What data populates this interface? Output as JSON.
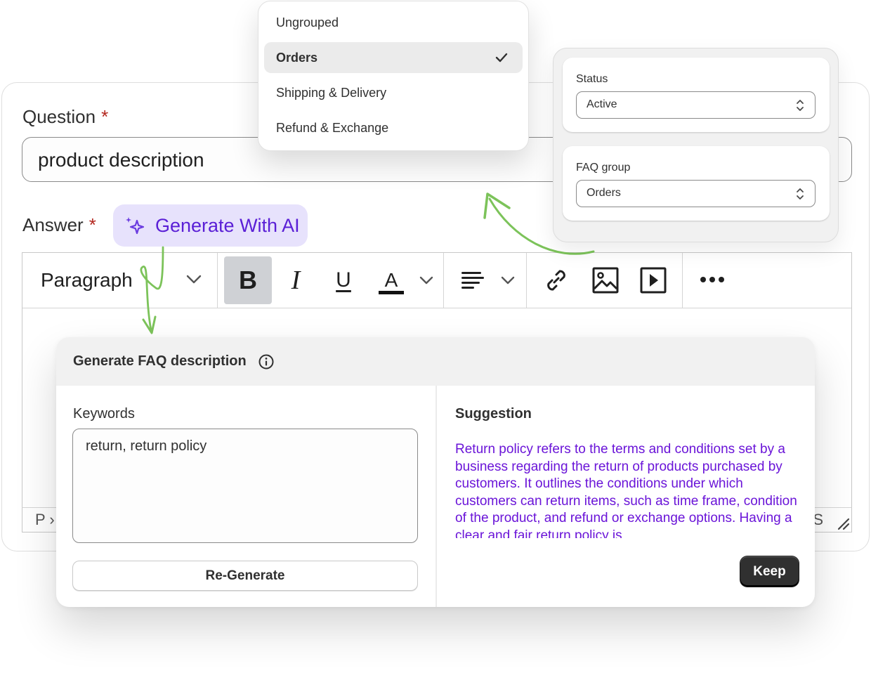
{
  "question": {
    "label": "Question",
    "required_mark": "*",
    "value": "product description"
  },
  "answer": {
    "label": "Answer",
    "required_mark": "*",
    "ai_button_label": "Generate With AI"
  },
  "toolbar": {
    "paragraph_label": "Paragraph",
    "bold": "B",
    "italic": "I",
    "underline": "U",
    "text_color": "A"
  },
  "status_bar": {
    "path": "P ›",
    "word_count": "S"
  },
  "group_dropdown": {
    "options": [
      "Ungrouped",
      "Orders",
      "Shipping & Delivery",
      "Refund & Exchange"
    ],
    "selected": "Orders"
  },
  "settings": {
    "status": {
      "label": "Status",
      "value": "Active"
    },
    "faq_group": {
      "label": "FAQ group",
      "value": "Orders"
    }
  },
  "generate_panel": {
    "title": "Generate FAQ description",
    "keywords_label": "Keywords",
    "keywords_value": "return, return policy",
    "regenerate_label": "Re-Generate",
    "suggestion_label": "Suggestion",
    "suggestion_text": "Return policy refers to the terms and conditions set by a business regarding the return of products purchased by customers. It outlines the conditions under which customers can return items, such as time frame, condition of the product, and refund or exchange options. Having a clear and fair return policy is",
    "keep_label": "Keep"
  },
  "colors": {
    "accent_purple": "#5a1fd6",
    "suggestion_text": "#6a14d8",
    "ai_button_bg": "#e7e2fc",
    "arrow_green": "#7cc35a",
    "required_red": "#b3261e",
    "keep_button_bg": "#303030"
  }
}
